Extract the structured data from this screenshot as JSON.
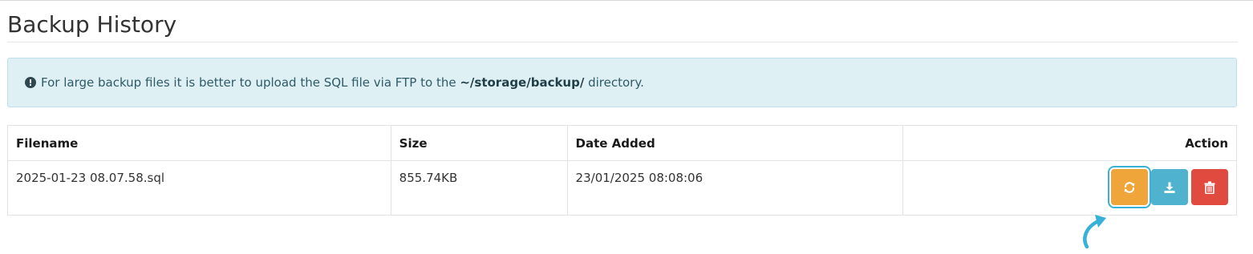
{
  "page": {
    "title": "Backup History"
  },
  "alert": {
    "icon": "exclamation-circle-icon",
    "text_before": "For large backup files it is better to upload the SQL file via FTP to the",
    "path": "~/storage/backup/",
    "text_after": "directory."
  },
  "table": {
    "columns": [
      "Filename",
      "Size",
      "Date Added",
      "Action"
    ],
    "rows": [
      {
        "filename": "2025-01-23 08.07.58.sql",
        "size": "855.74KB",
        "date_added": "23/01/2025 08:08:06"
      }
    ]
  },
  "actions": {
    "restore_icon": "refresh-icon",
    "download_icon": "download-icon",
    "delete_icon": "trash-icon"
  },
  "colors": {
    "restore": "#f0a53a",
    "download": "#4fb3cf",
    "delete": "#e04a3f",
    "alert_bg": "#dff0f5",
    "highlight": "#37b1d8"
  }
}
